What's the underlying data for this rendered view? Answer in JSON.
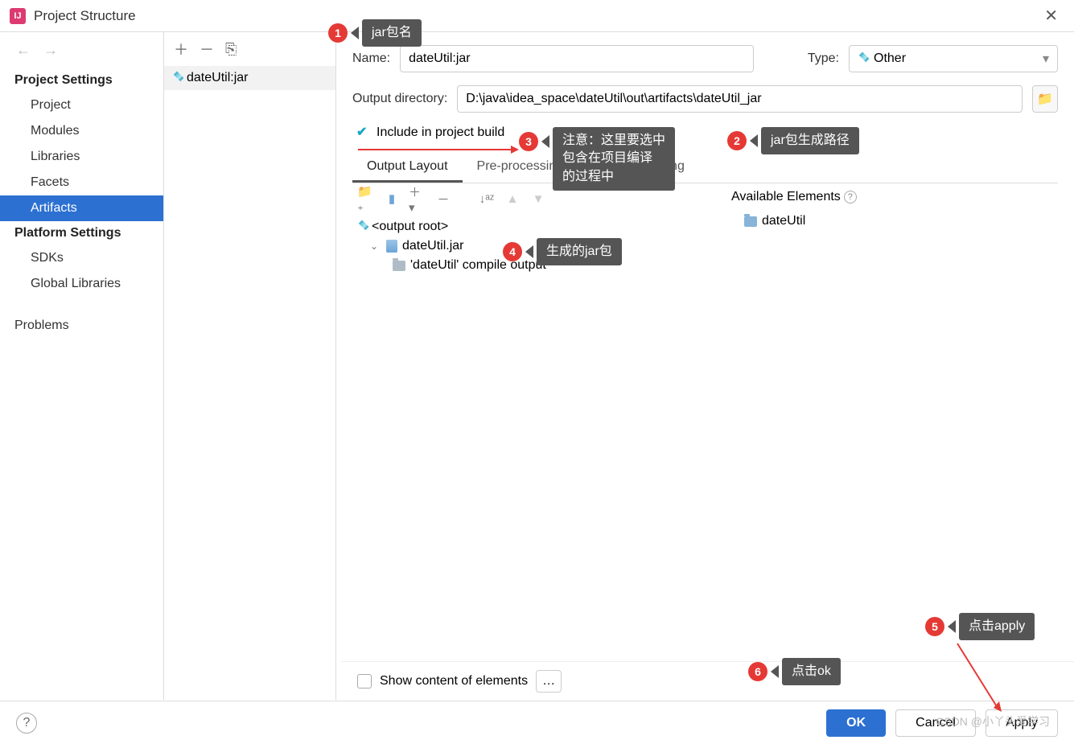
{
  "window": {
    "title": "Project Structure"
  },
  "sidebar": {
    "project_settings_header": "Project Settings",
    "platform_settings_header": "Platform Settings",
    "items": [
      "Project",
      "Modules",
      "Libraries",
      "Facets",
      "Artifacts"
    ],
    "platform_items": [
      "SDKs",
      "Global Libraries"
    ],
    "problems": "Problems"
  },
  "artifacts": {
    "list_item": "dateUtil:jar"
  },
  "detail": {
    "name_label": "Name:",
    "name_value": "dateUtil:jar",
    "type_label": "Type:",
    "type_value": "Other",
    "output_dir_label": "Output directory:",
    "output_dir_value": "D:\\java\\idea_space\\dateUtil\\out\\artifacts\\dateUtil_jar",
    "include_build": "Include in project build",
    "tabs": [
      "Output Layout",
      "Pre-processing",
      "Post-processing"
    ],
    "tree": {
      "root": "<output root>",
      "jar": "dateUtil.jar",
      "compile": "'dateUtil' compile output"
    },
    "available_header": "Available Elements",
    "available_item": "dateUtil",
    "show_content": "Show content of elements"
  },
  "footer": {
    "ok": "OK",
    "cancel": "Cancel",
    "apply": "Apply"
  },
  "annotations": {
    "a1": "jar包名",
    "a2": "jar包生成路径",
    "a3": "注意：这里要选中\n包含在项目编译\n的过程中",
    "a4": "生成的jar包",
    "a5": "点击apply",
    "a6": "点击ok"
  },
  "watermark": "CSDN @小丫头爱学习"
}
